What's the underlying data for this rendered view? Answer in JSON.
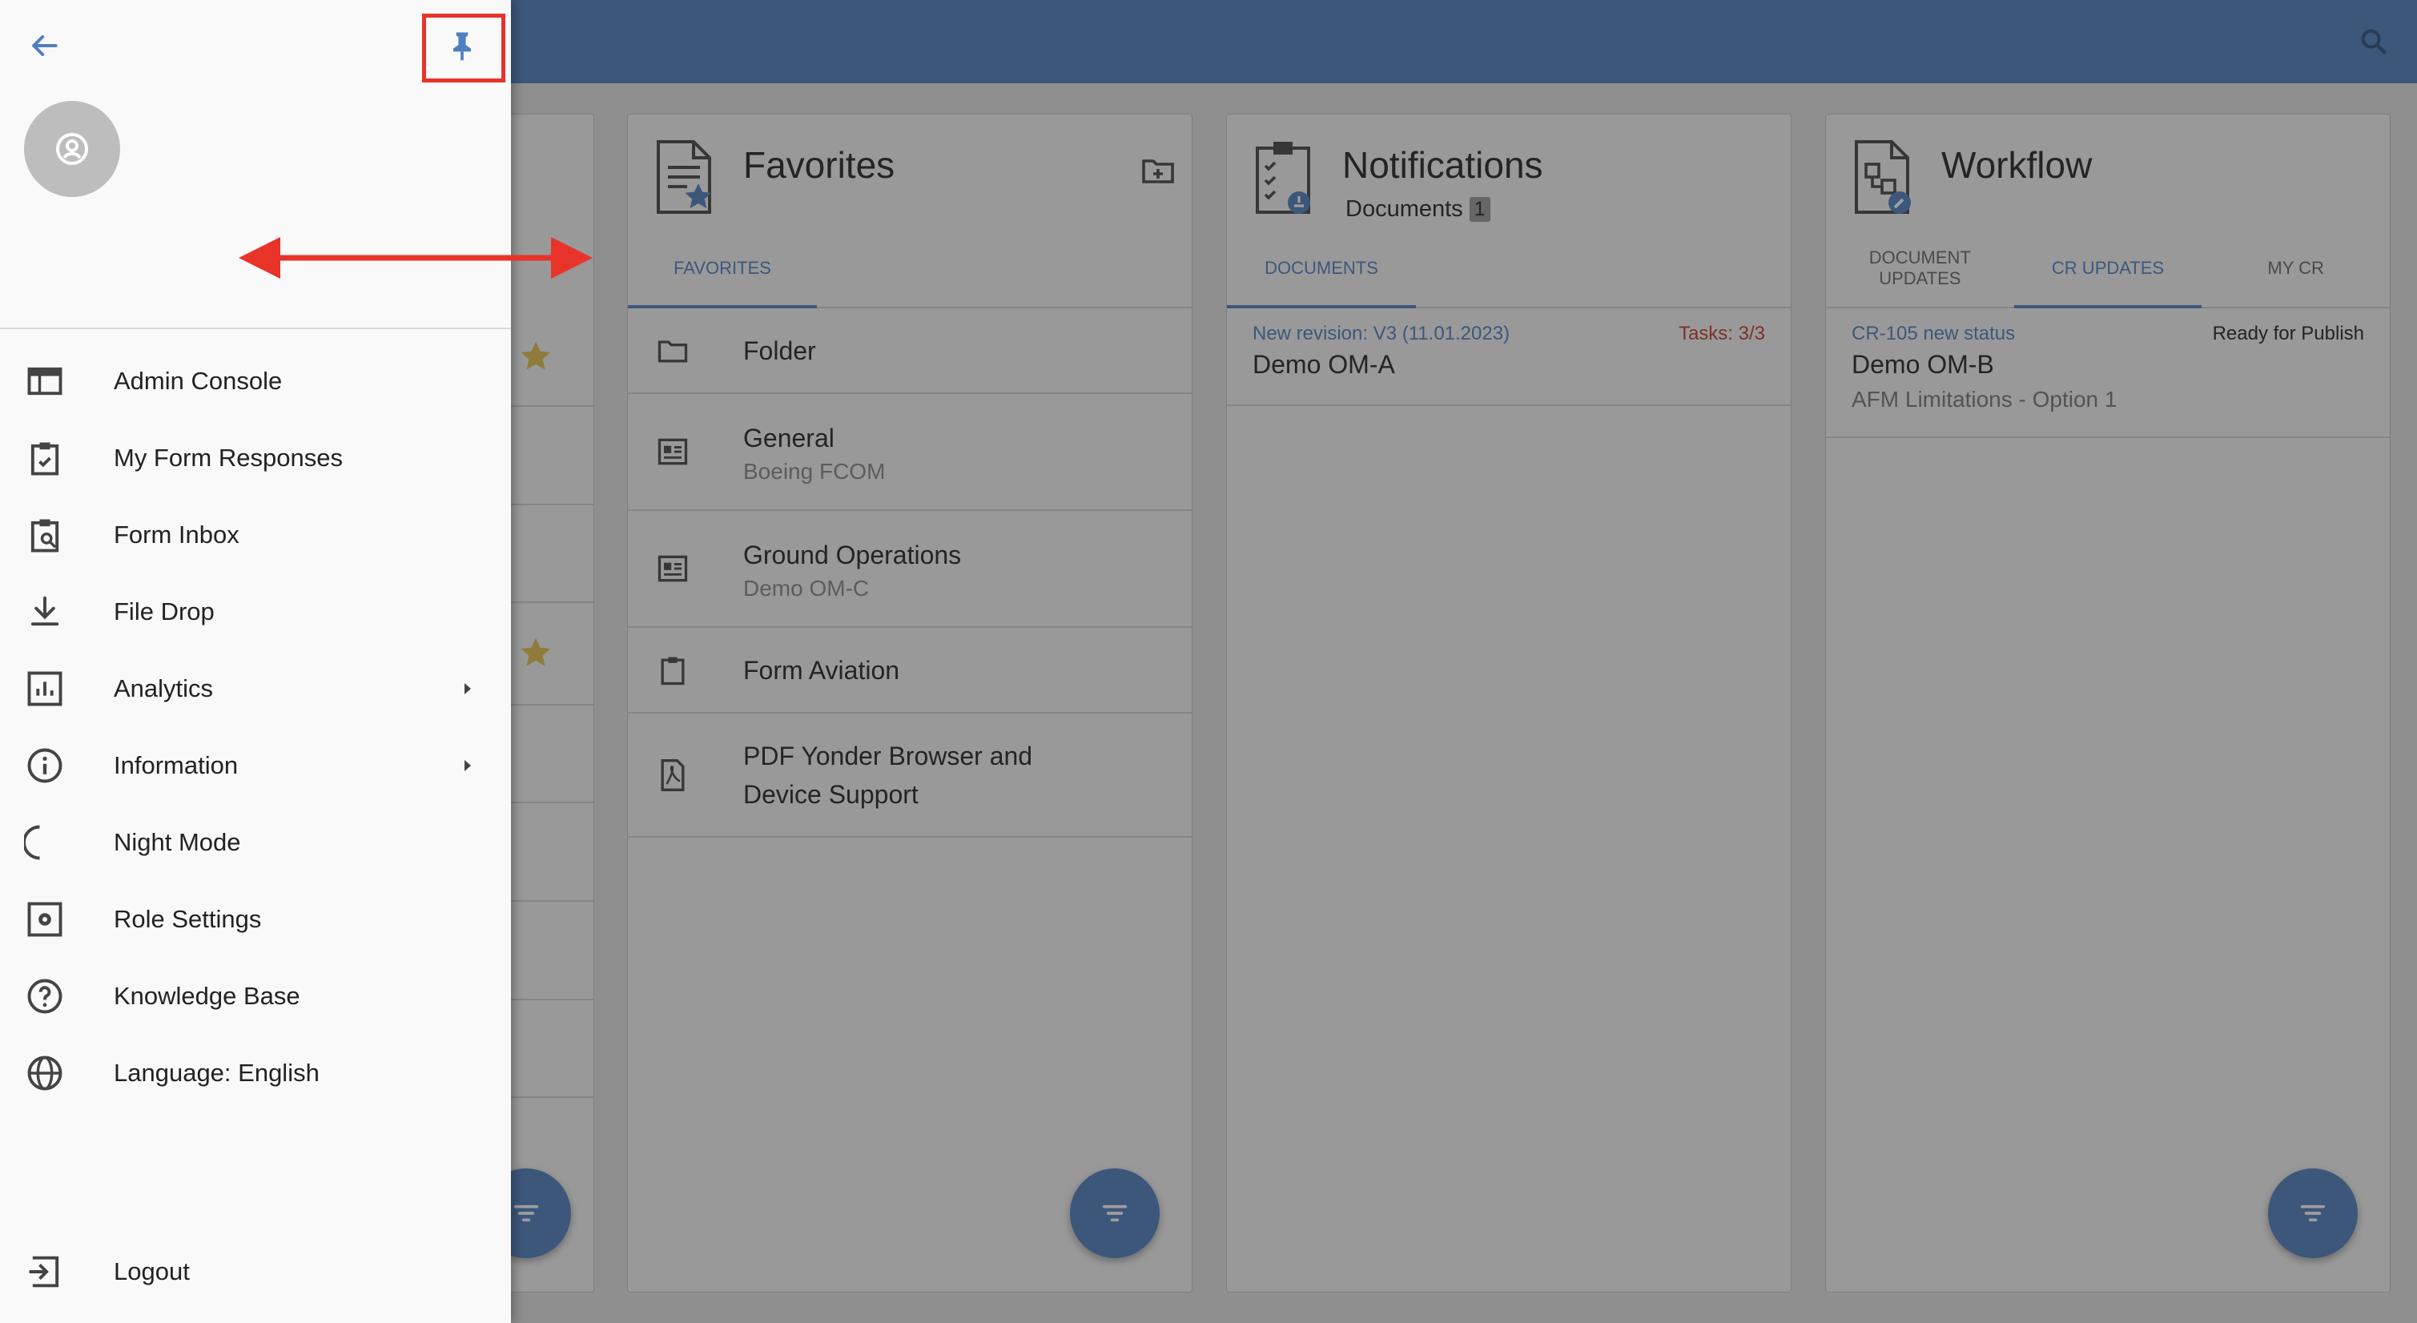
{
  "colors": {
    "accent": "#4f7fc0",
    "highlight": "#e8332a",
    "star": "#e6c14a",
    "warning": "#c0392b"
  },
  "favorites": {
    "title": "Favorites",
    "tab": "FAVORITES",
    "items": [
      {
        "title": "Folder",
        "subtitle": ""
      },
      {
        "title": "General",
        "subtitle": "Boeing FCOM"
      },
      {
        "title": "Ground Operations",
        "subtitle": "Demo OM-C"
      },
      {
        "title": "Form Aviation",
        "subtitle": ""
      },
      {
        "title": "PDF Yonder Browser and Device Support",
        "subtitle": ""
      }
    ]
  },
  "notifications": {
    "title": "Notifications",
    "subtitle": "Documents",
    "count": "1",
    "tab": "DOCUMENTS",
    "items": [
      {
        "link": "New revision: V3 (11.01.2023)",
        "status": "Tasks: 3/3",
        "title": "Demo OM-A"
      }
    ]
  },
  "workflow": {
    "title": "Workflow",
    "tabs": [
      "DOCUMENT UPDATES",
      "CR UPDATES",
      "MY CR"
    ],
    "items": [
      {
        "link": "CR-105 new status",
        "status": "Ready for Publish",
        "title": "Demo OM-B",
        "subtitle": "AFM Limitations - Option 1"
      }
    ]
  },
  "drawer": {
    "menu": [
      {
        "label": "Admin Console",
        "icon": "admin-console-icon"
      },
      {
        "label": "My Form Responses",
        "icon": "form-responses-icon"
      },
      {
        "label": "Form Inbox",
        "icon": "form-inbox-icon"
      },
      {
        "label": "File Drop",
        "icon": "download-icon"
      },
      {
        "label": "Analytics",
        "icon": "analytics-icon"
      },
      {
        "label": "Information",
        "icon": "info-icon"
      },
      {
        "label": "Night Mode",
        "icon": "moon-icon"
      },
      {
        "label": "Role Settings",
        "icon": "role-settings-icon"
      },
      {
        "label": "Knowledge Base",
        "icon": "help-icon"
      },
      {
        "label": "Language: English",
        "icon": "globe-icon"
      }
    ],
    "logout": "Logout"
  }
}
